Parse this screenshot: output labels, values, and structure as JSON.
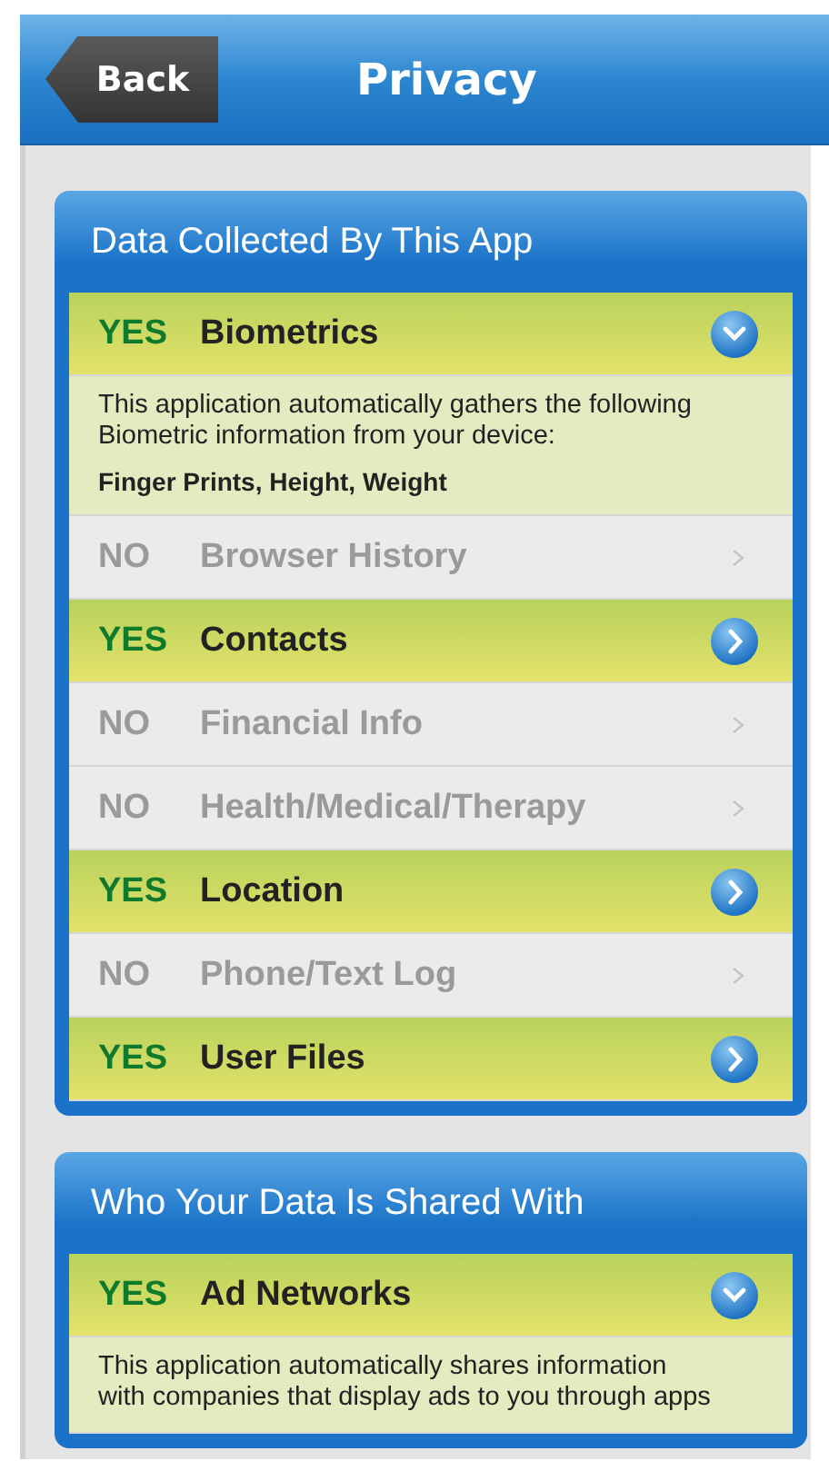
{
  "header": {
    "back": "Back",
    "title": "Privacy"
  },
  "sections": [
    {
      "title": "Data Collected By This App",
      "items": [
        {
          "answer": "YES",
          "label": "Biometrics",
          "disabled": false,
          "expanded": true,
          "description": "This application automatically gathers the following Biometric information from your device:",
          "details": "Finger Prints, Height, Weight"
        },
        {
          "answer": "NO",
          "label": "Browser History",
          "disabled": true
        },
        {
          "answer": "YES",
          "label": "Contacts",
          "disabled": false,
          "expanded": false
        },
        {
          "answer": "NO",
          "label": "Financial Info",
          "disabled": true
        },
        {
          "answer": "NO",
          "label": "Health/Medical/Therapy",
          "disabled": true
        },
        {
          "answer": "YES",
          "label": "Location",
          "disabled": false,
          "expanded": false
        },
        {
          "answer": "NO",
          "label": "Phone/Text Log",
          "disabled": true
        },
        {
          "answer": "YES",
          "label": "User Files",
          "disabled": false,
          "expanded": false
        }
      ]
    },
    {
      "title": "Who Your Data Is Shared With",
      "items": [
        {
          "answer": "YES",
          "label": "Ad Networks",
          "disabled": false,
          "expanded": true,
          "description": "This application automatically shares information with companies that display ads to you through apps"
        }
      ]
    }
  ]
}
